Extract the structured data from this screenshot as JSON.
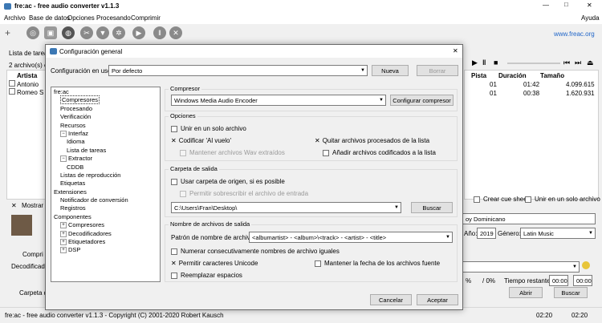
{
  "main": {
    "title": "fre:ac - free audio converter v1.1.3",
    "win_min": "—",
    "win_max": "□",
    "win_close": "✕",
    "menu": [
      "Archivo",
      "Base de datos",
      "Opciones",
      "Procesando",
      "Comprimir"
    ],
    "help": "Ayuda",
    "link": "www.freac.org",
    "tasklist_label": "Lista de tareas",
    "count_label": "2 archivo(s) e",
    "col_artist": "Artista",
    "rows": [
      {
        "artist": "Antonio",
        "track": "01",
        "duration": "01:42",
        "size": "4.099.615"
      },
      {
        "artist": "Romeo S",
        "track": "01",
        "duration": "00:38",
        "size": "1.620.931"
      }
    ],
    "col_track": "Pista",
    "col_duration": "Duración",
    "col_size": "Tamaño",
    "show_label": "Mostrar ir",
    "cue_label": "Crear cue sheet",
    "single_file_label": "Unir en un solo archivo",
    "album_value": "oy Dominicano",
    "year_label": "Año:",
    "year_value": "2019",
    "genre_label": "Género:",
    "genre_value": "Latin Music",
    "compressor_short": "Compri",
    "decoder_short": "Decodificado",
    "target_short": "Carpeta d",
    "progress_pct1": "%",
    "progress_pct2": "/ 0%",
    "time_remaining_label": "Tiempo restante:",
    "time1": "00:00",
    "time2": "00:00",
    "open_button": "Abrir",
    "search_button": "Buscar",
    "status_text": "fre:ac - free audio converter v1.1.3 - Copyright (C) 2001-2020 Robert Kausch",
    "status_time1": "02:20",
    "status_time2": "02:20"
  },
  "dialog": {
    "title": "Configuración general",
    "close": "✕",
    "config_label": "Configuración en uso:",
    "config_value": "Por defecto",
    "new_button": "Nueva",
    "delete_button": "Borrar",
    "tree": [
      {
        "label": "fre:ac",
        "indent": 0,
        "exp": ""
      },
      {
        "label": "Compresores",
        "indent": 1,
        "exp": "",
        "selected": true
      },
      {
        "label": "Procesando",
        "indent": 1,
        "exp": ""
      },
      {
        "label": "Verificación",
        "indent": 1,
        "exp": ""
      },
      {
        "label": "Recursos",
        "indent": 1,
        "exp": ""
      },
      {
        "label": "Interfaz",
        "indent": 1,
        "exp": "−"
      },
      {
        "label": "Idioma",
        "indent": 2,
        "exp": ""
      },
      {
        "label": "Lista de tareas",
        "indent": 2,
        "exp": ""
      },
      {
        "label": "Extractor",
        "indent": 1,
        "exp": "−"
      },
      {
        "label": "CDDB",
        "indent": 2,
        "exp": ""
      },
      {
        "label": "Listas de reproducción",
        "indent": 1,
        "exp": ""
      },
      {
        "label": "Etiquetas",
        "indent": 1,
        "exp": ""
      },
      {
        "label": "Extensiones",
        "indent": 0,
        "exp": ""
      },
      {
        "label": "Notificador de conversión",
        "indent": 1,
        "exp": ""
      },
      {
        "label": "Registros",
        "indent": 1,
        "exp": ""
      },
      {
        "label": "Componentes",
        "indent": 0,
        "exp": ""
      },
      {
        "label": "Compresores",
        "indent": 1,
        "exp": "+"
      },
      {
        "label": "Decodificadores",
        "indent": 1,
        "exp": "+"
      },
      {
        "label": "Etiquetadores",
        "indent": 1,
        "exp": "+"
      },
      {
        "label": "DSP",
        "indent": 1,
        "exp": "+"
      }
    ],
    "compressor_group": "Compresor",
    "compressor_value": "Windows Media Audio Encoder",
    "configure_button": "Configurar compresor",
    "options_group": "Opciones",
    "opt_single_file": "Unir en un solo archivo",
    "opt_on_the_fly": "Codificar 'Al vuelo'",
    "opt_remove_processed": "Quitar archivos procesados de la lista",
    "opt_keep_wav": "Mantener archivos Wav extraídos",
    "opt_add_encoded": "Añadir archivos codificados a la lista",
    "output_group": "Carpeta de salida",
    "opt_use_source": "Usar carpeta de origen, si es posible",
    "opt_allow_overwrite": "Permitir sobrescribir el archivo de entrada",
    "output_path": "C:\\Users\\Fran\\Desktop\\",
    "browse_button": "Buscar",
    "filename_group": "Nombre de archivos de salida",
    "pattern_label": "Patrón de nombre de archivo:",
    "pattern_value": "<albumartist> - <album>\\<track> - <artist> - <title>",
    "opt_number_same": "Numerar consecutivamente nombres de archivo iguales",
    "opt_unicode": "Permitir caracteres Unicode",
    "opt_keep_date": "Mantener la fecha de los archivos fuente",
    "opt_replace_spaces": "Reemplazar espacios",
    "cancel_button": "Cancelar",
    "accept_button": "Aceptar",
    "check": "✕"
  }
}
